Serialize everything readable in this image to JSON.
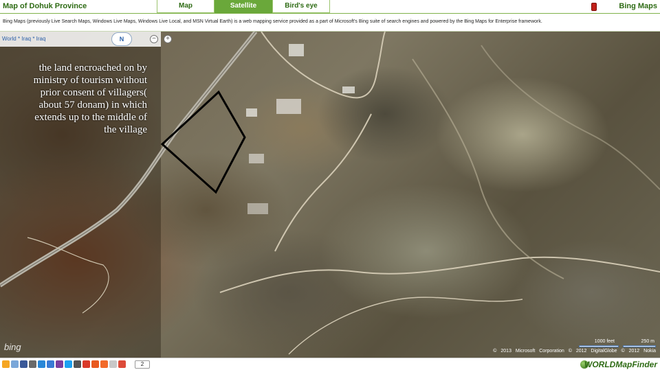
{
  "header": {
    "title": "Map of Dohuk Province",
    "tabs": [
      {
        "label": "Map",
        "active": false
      },
      {
        "label": "Satellite",
        "active": true
      },
      {
        "label": "Bird's eye",
        "active": false
      }
    ],
    "brand": "Bing Maps"
  },
  "description": "Bing Maps (previously Live Search Maps, Windows Live Maps, Windows Live Local, and MSN Virtual Earth) is a web mapping service provided as a part of Microsoft's Bing suite of search engines and powered by the Bing Maps for Enterprise framework.",
  "map": {
    "breadcrumb": "World * Iraq * Iraq",
    "compass_label": "N",
    "zoom_out_label": "−",
    "zoom_in_label": "+",
    "annotation_lines": [
      "the land encroached on by",
      "ministry of tourism without",
      "prior consent of villagers(",
      "about 57 donam) in which",
      "extends up to the middle of",
      "the village"
    ],
    "logo": "bing",
    "scale": {
      "feet": "1000 feet",
      "meters": "250 m"
    },
    "copyright": "© 2013 Microsoft Corporation   © 2012 DigitalGlobe   © 2012 Nokia"
  },
  "footer": {
    "share_count": "2",
    "brand": "WORLDMapFinder",
    "share_icon_colors": [
      "#f5a623",
      "#7aa7d9",
      "#3b5998",
      "#6a6a6a",
      "#2a88d8",
      "#3a7bd5",
      "#7b3fa0",
      "#1da1f2",
      "#555555",
      "#d93b2b",
      "#e85a20",
      "#f26a2a",
      "#c8c8c8",
      "#dd4b39"
    ]
  },
  "colors": {
    "accent": "#6aa83a",
    "text_green": "#2e6b14",
    "boundary": "#000000"
  }
}
